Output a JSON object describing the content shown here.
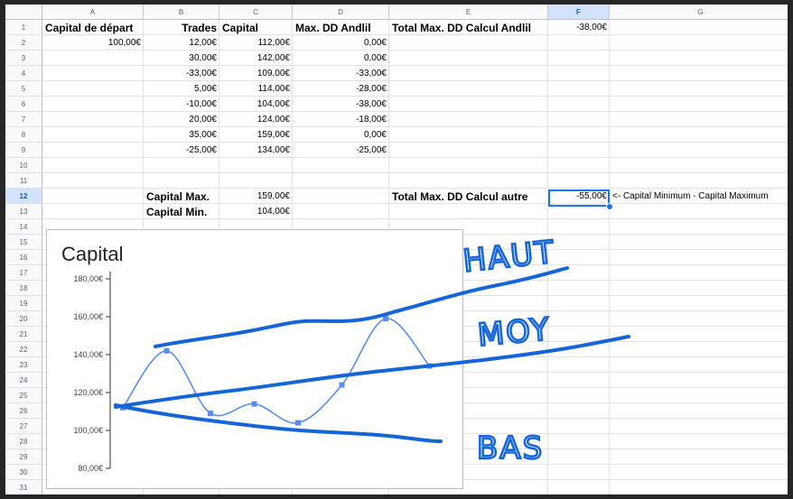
{
  "columns": [
    "A",
    "B",
    "C",
    "D",
    "E",
    "F",
    "G"
  ],
  "rows": [
    "1",
    "2",
    "3",
    "4",
    "5",
    "6",
    "7",
    "8",
    "9",
    "10",
    "11",
    "12",
    "13",
    "14",
    "15",
    "16",
    "17",
    "18",
    "19",
    "20",
    "21",
    "22",
    "23",
    "24",
    "25",
    "26",
    "27",
    "28",
    "29",
    "30",
    "31"
  ],
  "selected": {
    "column": "F",
    "row": "12"
  },
  "cells": {
    "A1": "Capital de départ",
    "B1": "Trades",
    "C1": "Capital",
    "D1": "Max. DD Andlil",
    "E1": "Total Max. DD Calcul Andlil",
    "F1": "-38,00€",
    "A2": "100,00€",
    "B": [
      "12,00€",
      "30,00€",
      "-33,00€",
      "5,00€",
      "-10,00€",
      "20,00€",
      "35,00€",
      "-25,00€"
    ],
    "C": [
      "112,00€",
      "142,00€",
      "109,00€",
      "114,00€",
      "104,00€",
      "124,00€",
      "159,00€",
      "134,00€"
    ],
    "D": [
      "0,00€",
      "0,00€",
      "-33,00€",
      "-28,00€",
      "-38,00€",
      "-18,00€",
      "0,00€",
      "-25,00€"
    ],
    "B12": "Capital Max.",
    "C12": "159,00€",
    "E12": "Total Max. DD Calcul autre",
    "F12": "-55,00€",
    "G12": "<- Capital Minimum - Capital Maximum",
    "B13": "Capital Min.",
    "C13": "104,00€"
  },
  "chart_data": {
    "type": "line",
    "title": "Capital",
    "x": [
      1,
      2,
      3,
      4,
      5,
      6,
      7,
      8
    ],
    "series": [
      {
        "values": [
          112,
          142,
          109,
          114,
          104,
          124,
          159,
          134
        ]
      }
    ],
    "yticks": [
      "180,00€",
      "160,00€",
      "140,00€",
      "120,00€",
      "100,00€",
      "80,00€"
    ],
    "ylim": [
      80,
      180
    ],
    "line_color": "#5b8def"
  },
  "annotations": {
    "haut": "HAUT",
    "moy": "MOY",
    "bas": "BAS",
    "ink_color": "#1565d8"
  }
}
